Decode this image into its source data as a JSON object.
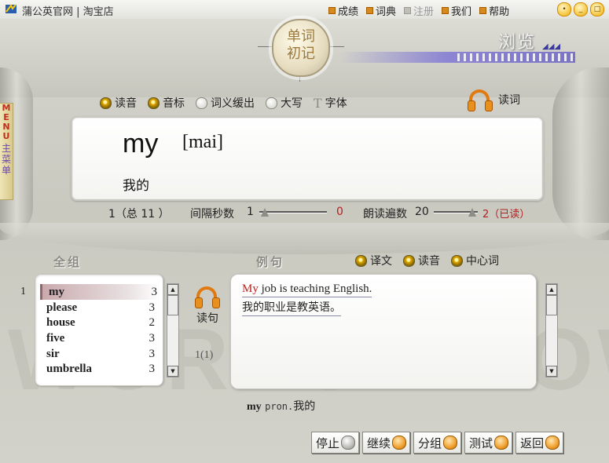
{
  "window": {
    "title": "蒲公英官网 | 淘宝店",
    "menu": [
      {
        "label": "成绩",
        "enabled": true
      },
      {
        "label": "词典",
        "enabled": true
      },
      {
        "label": "注册",
        "enabled": false
      },
      {
        "label": "我们",
        "enabled": true
      },
      {
        "label": "帮助",
        "enabled": true
      }
    ]
  },
  "logo": {
    "line1": "单词",
    "line2": "初记"
  },
  "mode_label": "浏览",
  "side_menu": {
    "en": "MENU",
    "cn": "主菜单"
  },
  "options": {
    "items": [
      {
        "label": "读音",
        "selected": true
      },
      {
        "label": "音标",
        "selected": true
      },
      {
        "label": "词义缓出",
        "selected": false
      },
      {
        "label": "大写",
        "selected": false
      }
    ],
    "font_label": "字体",
    "read_word_label": "读词"
  },
  "current_word": {
    "word": "my",
    "phonetic": "[mai]",
    "meaning": "我的"
  },
  "status": {
    "position_text": "1（总 11 ）",
    "interval_label": "间隔秒数",
    "interval_value": "1",
    "interval_count": "0",
    "repeat_label": "朗读遍数",
    "repeat_value": "20",
    "read_count": "2（已读）"
  },
  "sections": {
    "group_title": "全组",
    "example_title": "例句",
    "example_options": [
      {
        "label": "译文",
        "selected": true
      },
      {
        "label": "读音",
        "selected": true
      },
      {
        "label": "中心词",
        "selected": true
      }
    ]
  },
  "word_list": {
    "index": "1",
    "rows": [
      {
        "word": "my",
        "count": "3",
        "selected": true
      },
      {
        "word": "please",
        "count": "3",
        "selected": false
      },
      {
        "word": "house",
        "count": "2",
        "selected": false
      },
      {
        "word": "five",
        "count": "3",
        "selected": false
      },
      {
        "word": "sir",
        "count": "3",
        "selected": false
      },
      {
        "word": "umbrella",
        "count": "3",
        "selected": false
      }
    ]
  },
  "read_sentence": {
    "label": "读句",
    "count": "1(1)"
  },
  "example": {
    "highlight": "My",
    "english_rest": " job is teaching English.",
    "chinese": "我的职业是教英语。"
  },
  "pronunciation": {
    "word": "my",
    "pos": "pron.",
    "meaning": "我的"
  },
  "buttons": [
    "停止",
    "继续",
    "分组",
    "测试",
    "返回"
  ],
  "watermark": "WORDS KNOWN",
  "colors": {
    "accent": "#e07a10",
    "highlight_red": "#c02020",
    "selection": "#caa9ad"
  }
}
